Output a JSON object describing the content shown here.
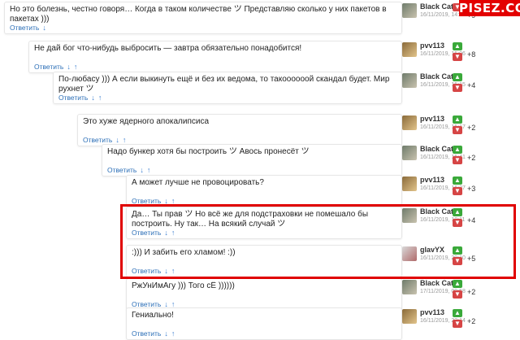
{
  "watermark": "PISEZ.COM",
  "highlight_color": "#e00000",
  "vote_up_color": "#3aa93a",
  "vote_down_color": "#d64545",
  "reply_label": "Ответить",
  "down_arrow": "↓",
  "up_arrow": "↑",
  "comments": [
    {
      "text": "Но это болезнь, честно говоря… Когда в таком количестве ツ Представляю сколько у них пакетов в пакетах )))",
      "author": "Black Cat",
      "date": "16/11/2019, 14:02",
      "score": "+9",
      "avatar": "black-cat-avatar",
      "has_up": false
    },
    {
      "text": "Не дай бог что-нибудь выбросить — завтра обязательно понадобится!",
      "author": "pvv113",
      "date": "16/11/2019, 15:06",
      "score": "+8",
      "avatar": "pvv113-avatar",
      "has_up": true
    },
    {
      "text": "По-любасу ))) А если выкинуть ещё и без их ведома, то такоооооой скандал будет. Мир рухнет ツ",
      "author": "Black Cat",
      "date": "16/11/2019, 15:15",
      "score": "+4",
      "avatar": "black-cat-avatar",
      "has_up": true
    },
    {
      "text": "Это хуже ядерного апокалипсиса",
      "author": "pvv113",
      "date": "16/11/2019, 15:17",
      "score": "+2",
      "avatar": "pvv113-avatar",
      "has_up": true
    },
    {
      "text": "Надо бункер хотя бы построить ツ Авось пронесёт ツ",
      "author": "Black Cat",
      "date": "16/11/2019, 15:41",
      "score": "+2",
      "avatar": "black-cat-avatar",
      "has_up": true
    },
    {
      "text": "А может лучше не провоцировать?",
      "author": "pvv113",
      "date": "16/11/2019, 16:27",
      "score": "+3",
      "avatar": "pvv113-avatar",
      "has_up": true
    },
    {
      "text": "Да… Ты прав ツ Но всё же для подстраховки не помешало бы построить. Ну так… На всякий случай ツ",
      "author": "Black Cat",
      "date": "16/11/2019, 18:11",
      "score": "+4",
      "avatar": "black-cat-avatar",
      "has_up": true
    },
    {
      "text": ":))) И забить его хламом! :))",
      "author": "glavYX",
      "date": "16/11/2019, 20:10",
      "score": "+5",
      "avatar": "glavyx-avatar",
      "has_up": true
    },
    {
      "text": "РжУнИмАгу ))) Того сЁ ))))))",
      "author": "Black Cat",
      "date": "17/11/2019, 09:58",
      "score": "+2",
      "avatar": "black-cat-avatar",
      "has_up": true
    },
    {
      "text": "Гениально!",
      "author": "pvv113",
      "date": "16/11/2019, 22:14",
      "score": "+2",
      "avatar": "pvv113-avatar",
      "has_up": true
    }
  ]
}
